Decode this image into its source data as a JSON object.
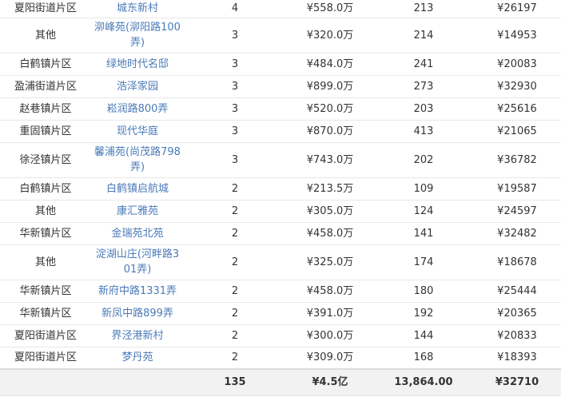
{
  "rows": [
    {
      "area": "夏阳街道片区",
      "community": "城东新村",
      "count": "4",
      "total_price": "¥558.0万",
      "deals": "213",
      "unit_price": "¥26197"
    },
    {
      "area": "其他",
      "community": "泖峰苑(泖阳路100弄)",
      "count": "3",
      "total_price": "¥320.0万",
      "deals": "214",
      "unit_price": "¥14953"
    },
    {
      "area": "白鹤镇片区",
      "community": "绿地时代名邸",
      "count": "3",
      "total_price": "¥484.0万",
      "deals": "241",
      "unit_price": "¥20083"
    },
    {
      "area": "盈浦街道片区",
      "community": "浩泽家园",
      "count": "3",
      "total_price": "¥899.0万",
      "deals": "273",
      "unit_price": "¥32930"
    },
    {
      "area": "赵巷镇片区",
      "community": "崧润路800弄",
      "count": "3",
      "total_price": "¥520.0万",
      "deals": "203",
      "unit_price": "¥25616"
    },
    {
      "area": "重固镇片区",
      "community": "现代华庭",
      "count": "3",
      "total_price": "¥870.0万",
      "deals": "413",
      "unit_price": "¥21065"
    },
    {
      "area": "徐泾镇片区",
      "community": "馨浦苑(尚茂路798弄)",
      "count": "3",
      "total_price": "¥743.0万",
      "deals": "202",
      "unit_price": "¥36782"
    },
    {
      "area": "白鹤镇片区",
      "community": "白鹤镇启航城",
      "count": "2",
      "total_price": "¥213.5万",
      "deals": "109",
      "unit_price": "¥19587"
    },
    {
      "area": "其他",
      "community": "康汇雅苑",
      "count": "2",
      "total_price": "¥305.0万",
      "deals": "124",
      "unit_price": "¥24597"
    },
    {
      "area": "华新镇片区",
      "community": "金瑞苑北苑",
      "count": "2",
      "total_price": "¥458.0万",
      "deals": "141",
      "unit_price": "¥32482"
    },
    {
      "area": "其他",
      "community": "淀湖山庄(河畔路301弄)",
      "count": "2",
      "total_price": "¥325.0万",
      "deals": "174",
      "unit_price": "¥18678"
    },
    {
      "area": "华新镇片区",
      "community": "新府中路1331弄",
      "count": "2",
      "total_price": "¥458.0万",
      "deals": "180",
      "unit_price": "¥25444"
    },
    {
      "area": "华新镇片区",
      "community": "新凤中路899弄",
      "count": "2",
      "total_price": "¥391.0万",
      "deals": "192",
      "unit_price": "¥20365"
    },
    {
      "area": "夏阳街道片区",
      "community": "界泾港新村",
      "count": "2",
      "total_price": "¥300.0万",
      "deals": "144",
      "unit_price": "¥20833"
    },
    {
      "area": "夏阳街道片区",
      "community": "梦丹苑",
      "count": "2",
      "total_price": "¥309.0万",
      "deals": "168",
      "unit_price": "¥18393"
    }
  ],
  "totals": {
    "area": "",
    "community": "",
    "count": "135",
    "total_price": "¥4.5亿",
    "deals": "13,864.00",
    "unit_price": "¥32710"
  },
  "colors": {
    "link": "#4a7ab8",
    "text": "#333333",
    "border": "#e8e8e8",
    "total_bg": "#f2f2f2"
  }
}
